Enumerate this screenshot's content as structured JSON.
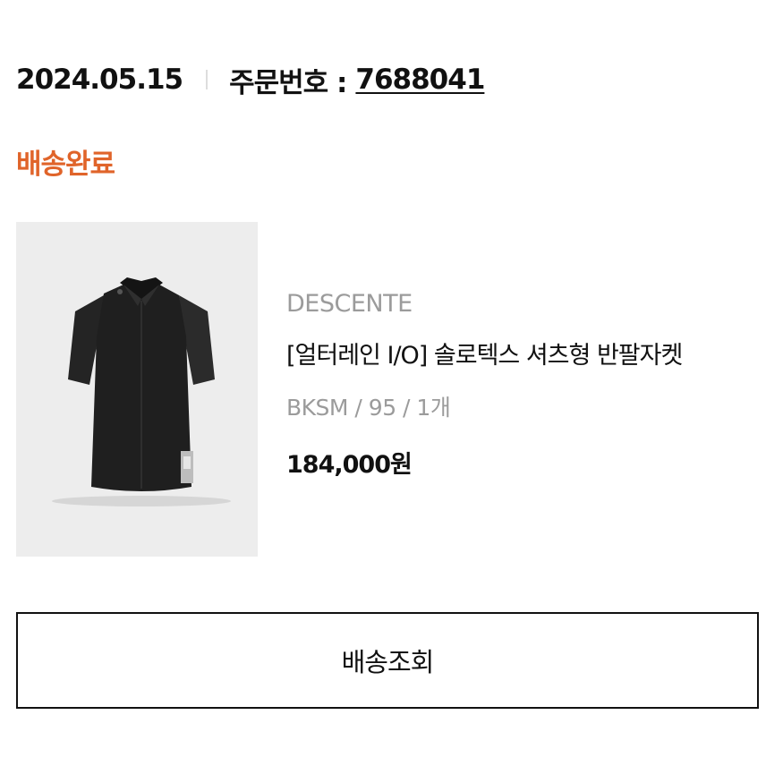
{
  "order": {
    "date": "2024.05.15",
    "number_label": "주문번호 :",
    "number": "7688041"
  },
  "status": {
    "text": "배송완료",
    "color": "#e0642a"
  },
  "product": {
    "image_icon": "shirt-image",
    "brand": "DESCENTE",
    "name": "[얼터레인 I/O] 솔로텍스 셔츠형 반팔자켓",
    "option": "BKSM / 95 / 1개",
    "price": "184,000원"
  },
  "actions": {
    "track_label": "배송조회"
  }
}
